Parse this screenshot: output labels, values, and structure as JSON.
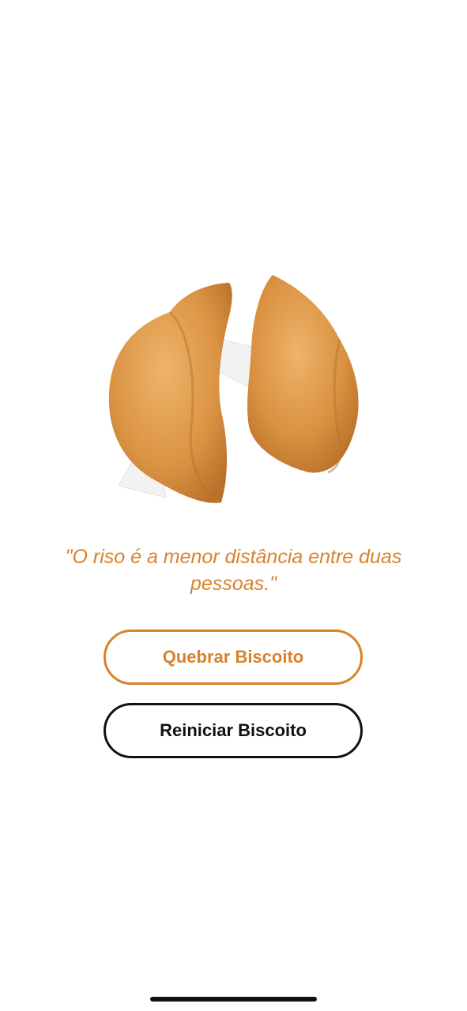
{
  "app": {
    "image": {
      "icon": "broken-fortune-cookie",
      "colors": {
        "cookie_light": "#E9A85A",
        "cookie_mid": "#D9913F",
        "cookie_dark": "#B8732A",
        "paper": "#F4F4F4"
      }
    },
    "quote": "\"O riso é a menor distância entre duas pessoas.\"",
    "buttons": {
      "break_label": "Quebrar Biscoito",
      "reset_label": "Reiniciar Biscoito"
    },
    "accent_color": "#D9822B"
  }
}
